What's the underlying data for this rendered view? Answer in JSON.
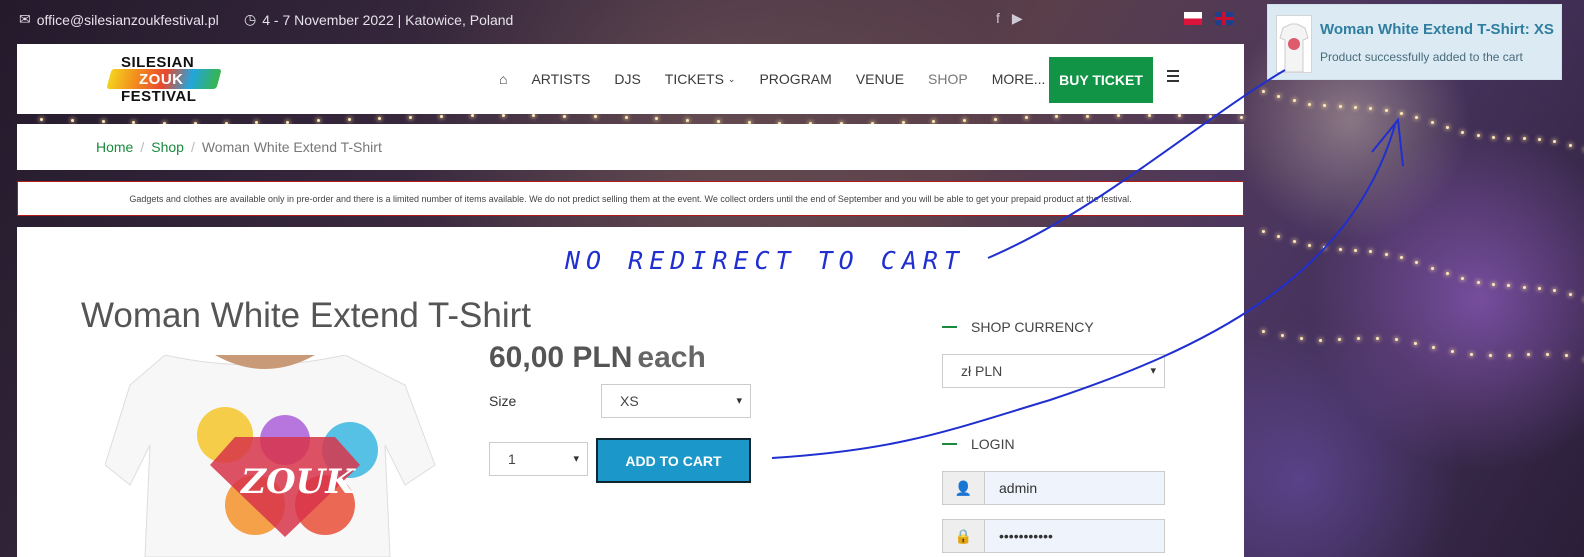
{
  "topbar": {
    "email": "office@silesianzoukfestival.pl",
    "dates": "4 - 7 November 2022 | Katowice, Poland",
    "social_icons": [
      "facebook-icon",
      "youtube-icon"
    ],
    "languages": [
      "pl-flag",
      "en-flag"
    ]
  },
  "header": {
    "logo_lines": [
      "SILESIAN",
      "ZOUK",
      "FESTIVAL"
    ],
    "nav": [
      "ARTISTS",
      "DJS",
      "TICKETS",
      "PROGRAM",
      "VENUE",
      "SHOP",
      "MORE..."
    ],
    "buy_label": "BUY TICKET",
    "brand_color": "#129447"
  },
  "breadcrumb": {
    "home": "Home",
    "shop": "Shop",
    "current": "Woman White Extend T-Shirt"
  },
  "notice": "Gadgets and clothes are available only in pre-order and there is a limited number of items available. We do not predict selling them at the event. We collect orders until the end of September and you will be able to get your prepaid product at the festival.",
  "annotation": "NO REDIRECT TO CART",
  "product": {
    "title": "Woman White Extend T-Shirt",
    "price": "60,00 PLN",
    "price_suffix": "each",
    "size_label": "Size",
    "size_value": "XS",
    "qty_value": "1",
    "add_to_cart": "ADD TO CART",
    "image_text": "ZOUK"
  },
  "sidebar": {
    "currency_title": "SHOP CURRENCY",
    "currency_value": "zł PLN",
    "login_title": "LOGIN",
    "username": "admin",
    "password_mask": "•••••••••••"
  },
  "toast": {
    "title": "Woman White Extend T-Shirt: XS",
    "message": "Product successfully added to the cart"
  }
}
